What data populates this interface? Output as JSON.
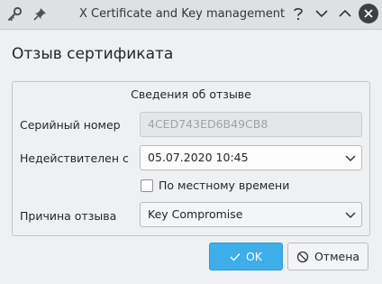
{
  "window": {
    "title": "X Certificate and Key management <2>",
    "icons": [
      "key-icon",
      "pin-icon",
      "help-icon",
      "minimize-icon",
      "maximize-icon",
      "close-icon"
    ]
  },
  "dialog": {
    "title": "Отзыв сертификата",
    "group_title": "Сведения об отзыве",
    "serial": {
      "label": "Серийный номер",
      "value": "4CED743ED6B49CB8"
    },
    "invalid_since": {
      "label": "Недействителен с",
      "value": "05.07.2020 10:45"
    },
    "local_time": {
      "label": "По местному времени",
      "checked": false
    },
    "reason": {
      "label": "Причина отзыва",
      "value": "Key Compromise"
    }
  },
  "buttons": {
    "ok": "OK",
    "cancel": "Отмена"
  },
  "colors": {
    "accent": "#3daee9",
    "background": "#eff0f1",
    "titlebar": "#dee0e2"
  }
}
